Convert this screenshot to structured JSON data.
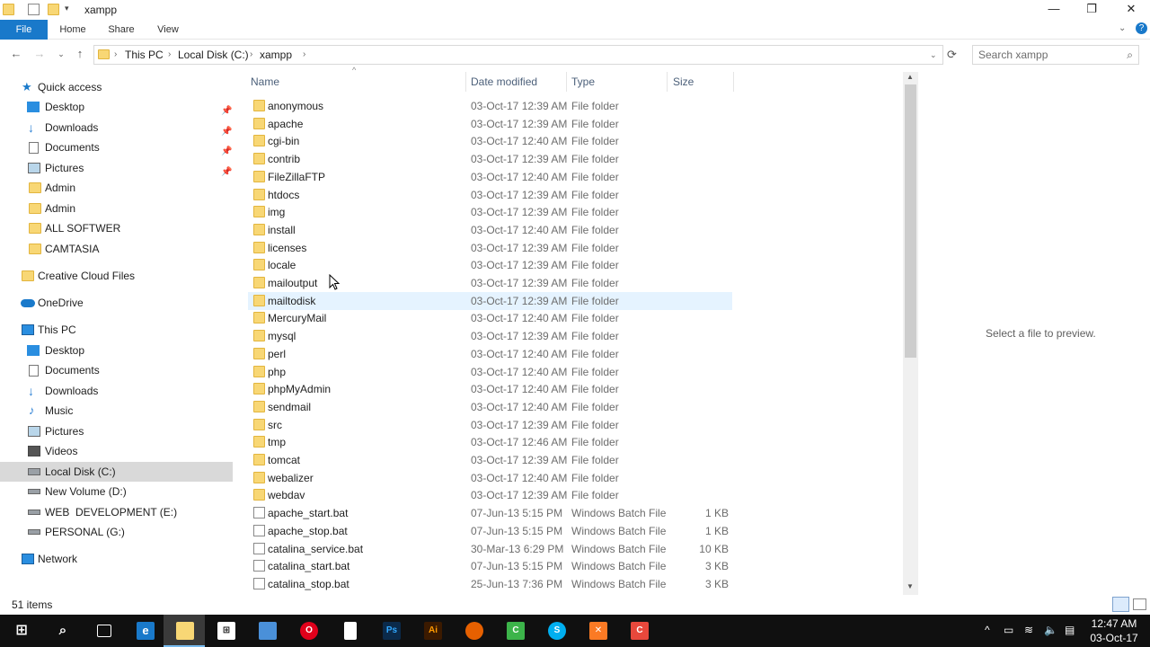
{
  "window": {
    "title": "xampp"
  },
  "ribbon": {
    "tabs": [
      "File",
      "Home",
      "Share",
      "View"
    ]
  },
  "address": {
    "crumbs": [
      "This PC",
      "Local Disk (C:)",
      "xampp"
    ]
  },
  "search": {
    "placeholder": "Search xampp"
  },
  "nav": {
    "quick_access": "Quick access",
    "quick_items": [
      "Desktop",
      "Downloads",
      "Documents",
      "Pictures",
      "Admin",
      "Admin",
      "ALL SOFTWER",
      "CAMTASIA"
    ],
    "creative_cloud": "Creative Cloud Files",
    "onedrive": "OneDrive",
    "this_pc": "This PC",
    "pc_items": [
      "Desktop",
      "Documents",
      "Downloads",
      "Music",
      "Pictures",
      "Videos",
      "Local Disk (C:)",
      "New Volume (D:)",
      "WEB  DEVELOPMENT (E:)",
      "PERSONAL (G:)"
    ],
    "network": "Network"
  },
  "columns": {
    "name": "Name",
    "date": "Date modified",
    "type": "Type",
    "size": "Size"
  },
  "files": [
    {
      "name": "anonymous",
      "date": "03-Oct-17 12:39 AM",
      "type": "File folder",
      "size": ""
    },
    {
      "name": "apache",
      "date": "03-Oct-17 12:39 AM",
      "type": "File folder",
      "size": ""
    },
    {
      "name": "cgi-bin",
      "date": "03-Oct-17 12:40 AM",
      "type": "File folder",
      "size": ""
    },
    {
      "name": "contrib",
      "date": "03-Oct-17 12:39 AM",
      "type": "File folder",
      "size": ""
    },
    {
      "name": "FileZillaFTP",
      "date": "03-Oct-17 12:40 AM",
      "type": "File folder",
      "size": ""
    },
    {
      "name": "htdocs",
      "date": "03-Oct-17 12:39 AM",
      "type": "File folder",
      "size": ""
    },
    {
      "name": "img",
      "date": "03-Oct-17 12:39 AM",
      "type": "File folder",
      "size": ""
    },
    {
      "name": "install",
      "date": "03-Oct-17 12:40 AM",
      "type": "File folder",
      "size": ""
    },
    {
      "name": "licenses",
      "date": "03-Oct-17 12:39 AM",
      "type": "File folder",
      "size": ""
    },
    {
      "name": "locale",
      "date": "03-Oct-17 12:39 AM",
      "type": "File folder",
      "size": ""
    },
    {
      "name": "mailoutput",
      "date": "03-Oct-17 12:39 AM",
      "type": "File folder",
      "size": ""
    },
    {
      "name": "mailtodisk",
      "date": "03-Oct-17 12:39 AM",
      "type": "File folder",
      "size": ""
    },
    {
      "name": "MercuryMail",
      "date": "03-Oct-17 12:40 AM",
      "type": "File folder",
      "size": ""
    },
    {
      "name": "mysql",
      "date": "03-Oct-17 12:39 AM",
      "type": "File folder",
      "size": ""
    },
    {
      "name": "perl",
      "date": "03-Oct-17 12:40 AM",
      "type": "File folder",
      "size": ""
    },
    {
      "name": "php",
      "date": "03-Oct-17 12:40 AM",
      "type": "File folder",
      "size": ""
    },
    {
      "name": "phpMyAdmin",
      "date": "03-Oct-17 12:40 AM",
      "type": "File folder",
      "size": ""
    },
    {
      "name": "sendmail",
      "date": "03-Oct-17 12:40 AM",
      "type": "File folder",
      "size": ""
    },
    {
      "name": "src",
      "date": "03-Oct-17 12:39 AM",
      "type": "File folder",
      "size": ""
    },
    {
      "name": "tmp",
      "date": "03-Oct-17 12:46 AM",
      "type": "File folder",
      "size": ""
    },
    {
      "name": "tomcat",
      "date": "03-Oct-17 12:39 AM",
      "type": "File folder",
      "size": ""
    },
    {
      "name": "webalizer",
      "date": "03-Oct-17 12:40 AM",
      "type": "File folder",
      "size": ""
    },
    {
      "name": "webdav",
      "date": "03-Oct-17 12:39 AM",
      "type": "File folder",
      "size": ""
    },
    {
      "name": "apache_start.bat",
      "date": "07-Jun-13 5:15 PM",
      "type": "Windows Batch File",
      "size": "1 KB"
    },
    {
      "name": "apache_stop.bat",
      "date": "07-Jun-13 5:15 PM",
      "type": "Windows Batch File",
      "size": "1 KB"
    },
    {
      "name": "catalina_service.bat",
      "date": "30-Mar-13 6:29 PM",
      "type": "Windows Batch File",
      "size": "10 KB"
    },
    {
      "name": "catalina_start.bat",
      "date": "07-Jun-13 5:15 PM",
      "type": "Windows Batch File",
      "size": "3 KB"
    },
    {
      "name": "catalina_stop.bat",
      "date": "25-Jun-13 7:36 PM",
      "type": "Windows Batch File",
      "size": "3 KB"
    }
  ],
  "preview": {
    "text": "Select a file to preview."
  },
  "status": {
    "items": "51 items"
  },
  "taskbar": {
    "time": "12:47 AM",
    "date": "03-Oct-17"
  },
  "colors": {
    "accent": "#1979ca",
    "selection": "#e5f3ff",
    "folder": "#f8d775"
  }
}
